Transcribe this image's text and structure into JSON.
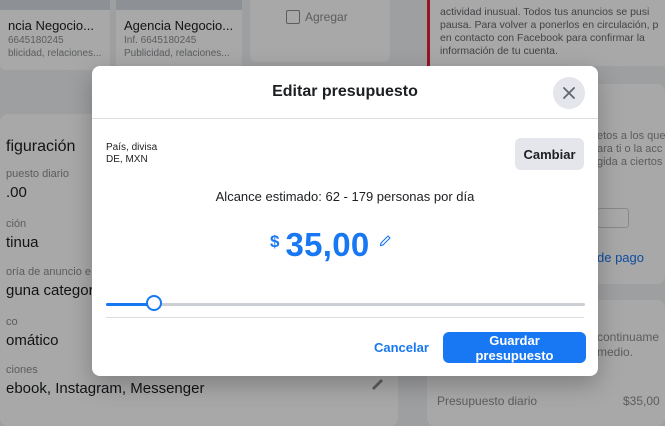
{
  "background": {
    "tiles": [
      {
        "name": "ncia Negocio...",
        "info": "6645180245",
        "desc": "blicidad, relaciones..."
      },
      {
        "name": "Agencia Negocio...",
        "info": "Inf. 6645180245",
        "desc": "Publicidad, relaciones..."
      }
    ],
    "add_label": "Agregar",
    "notice_lines": [
      "actividad inusual. Todos tus anuncios se pusi",
      "pausa. Para volver a ponerlos en circulación, p",
      "en contacto con Facebook para confirmar la",
      "información de tu cuenta."
    ],
    "config": {
      "title": "figuración",
      "daily_budget_label": "puesto diario",
      "daily_budget_value": ".00",
      "duration_label": "ción",
      "duration_value": "tinua",
      "category_label": "oría de anuncio e",
      "category_value": "guna categor",
      "placement_label": "co",
      "placement_value": "omático",
      "locations_label": "ciones",
      "locations_value": "ebook, Instagram, Messenger"
    },
    "right": {
      "info_lines": [
        "etos a los que",
        "ara ti o la acc",
        "gida a ciertos"
      ],
      "payment_link": "de pago",
      "continue_lines": [
        "continuame",
        "medio."
      ],
      "daily_budget_label": "Presupuesto diario",
      "daily_budget_value": "$35,00"
    }
  },
  "modal": {
    "title": "Editar presupuesto",
    "country_label": "País, divisa",
    "country_value": "DE, MXN",
    "change_button": "Cambiar",
    "reach": "Alcance estimado: 62 - 179 personas por día",
    "currency_symbol": "$",
    "amount": "35,00",
    "slider_fraction": 0.1,
    "cancel": "Cancelar",
    "save": "Guardar presupuesto"
  },
  "colors": {
    "accent": "#1877f2",
    "danger": "#e41e3f"
  }
}
